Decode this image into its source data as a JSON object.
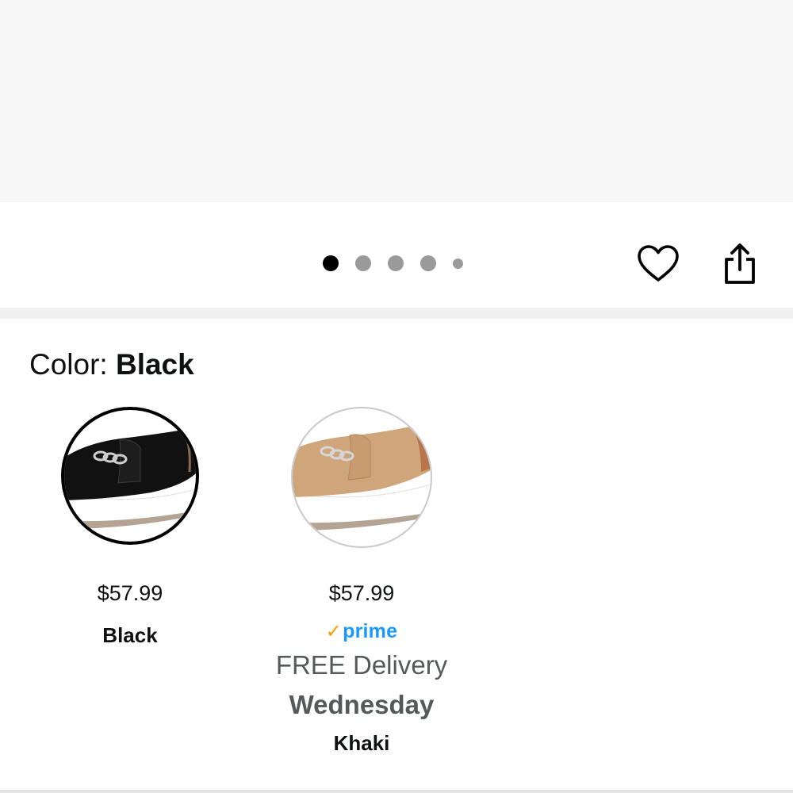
{
  "carousel": {
    "page_count": 5,
    "active_index": 0
  },
  "actions": {
    "wishlist_icon": "heart-outline-icon",
    "share_icon": "share-icon"
  },
  "color_selector": {
    "label": "Color: ",
    "selected": "Black",
    "options": [
      {
        "name": "Black",
        "price": "$57.99",
        "selected": true,
        "shoe_color": "#111111"
      },
      {
        "name": "Khaki",
        "price": "$57.99",
        "selected": false,
        "prime_check": "✓",
        "prime_label": "prime",
        "delivery_text": "FREE Delivery",
        "delivery_day": "Wednesday",
        "shoe_color": "#cfa57c"
      }
    ]
  },
  "colors": {
    "prime_blue": "#1a98ff",
    "prime_check": "#ff9900",
    "muted_text": "#565959"
  }
}
